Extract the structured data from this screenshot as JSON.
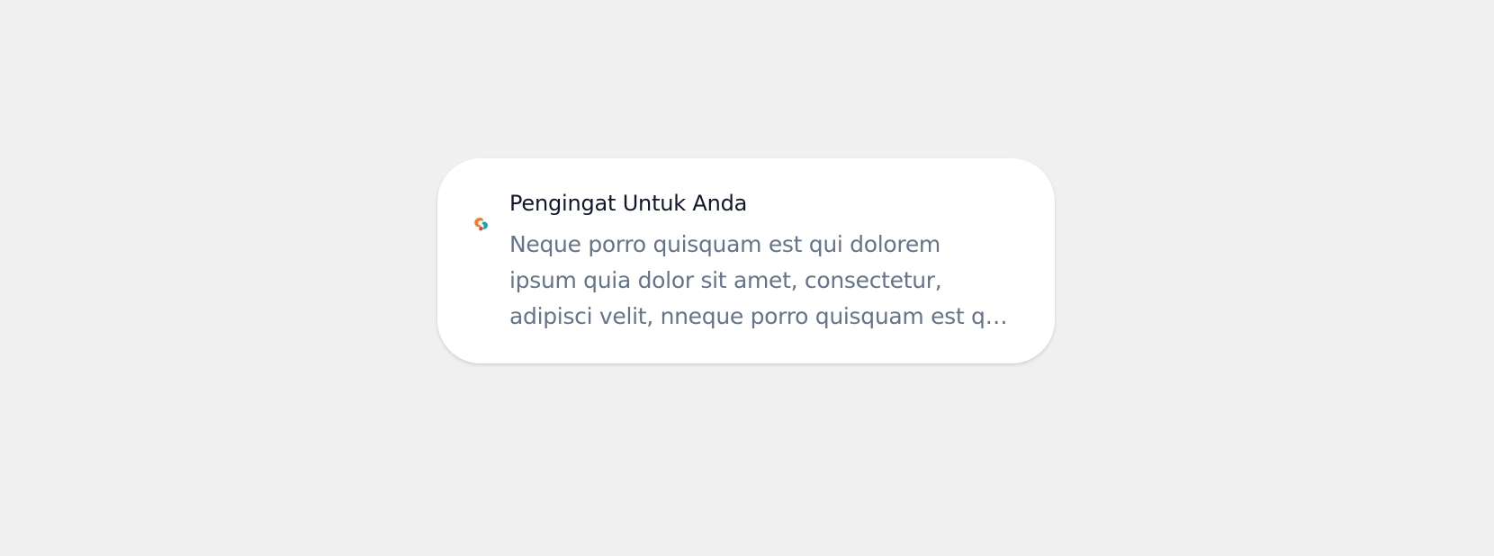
{
  "notification": {
    "icon": "app-logo-icon",
    "title": "Pengingat Untuk Anda",
    "message": "Neque porro quisquam est qui dolorem ipsum quia dolor sit amet, consectetur, adipisci velit, nneque porro quisquam est qui dolorem ipsum quia dolor sit amet",
    "colors": {
      "background": "#f0f0f0",
      "card": "#ffffff",
      "title": "#0f172a",
      "message": "#64748b",
      "logo_orange": "#f47b20",
      "logo_teal": "#16a3b8",
      "logo_red": "#e8432f"
    }
  }
}
